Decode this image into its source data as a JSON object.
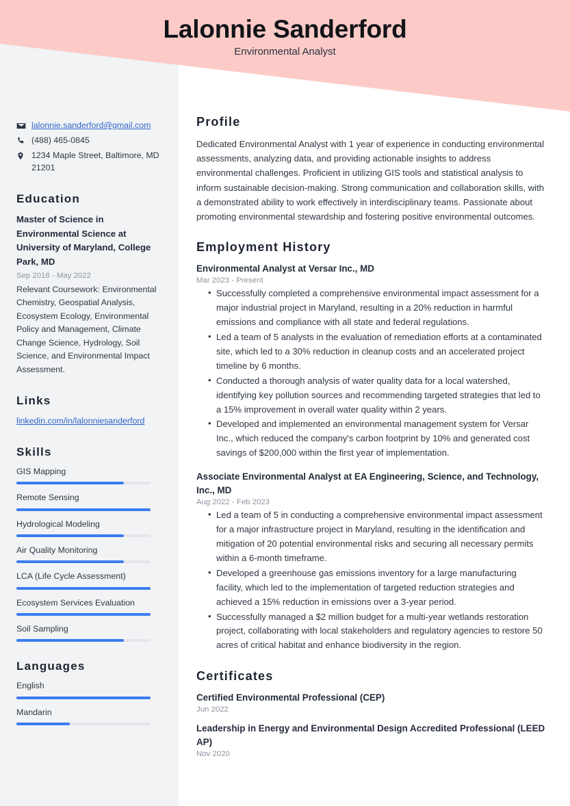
{
  "theme": {
    "band_color": "#fdcbc7",
    "sidebar_color": "#f1f3f5",
    "accent_color": "#3b7ced",
    "link_color": "#3064c8",
    "text_color": "#2f3642",
    "muted_color": "#8d939e"
  },
  "header": {
    "name": "Lalonnie Sanderford",
    "title": "Environmental Analyst"
  },
  "contact": {
    "items": [
      {
        "icon": "envelope-icon",
        "value": "lalonnie.sanderford@gmail.com",
        "is_link": true
      },
      {
        "icon": "phone-icon",
        "value": "(488) 465-0845",
        "is_link": false
      },
      {
        "icon": "map-pin-icon",
        "value": "1234 Maple Street, Baltimore, MD 21201",
        "is_link": false
      }
    ]
  },
  "education": {
    "heading": "Education",
    "entries": [
      {
        "degree": "Master of Science in Environmental Science at University of Maryland, College Park, MD",
        "date": "Sep 2018 - May 2022",
        "description": "Relevant Coursework: Environmental Chemistry, Geospatial Analysis, Ecosystem Ecology, Environmental Policy and Management, Climate Change Science, Hydrology, Soil Science, and Environmental Impact Assessment."
      }
    ]
  },
  "links": {
    "heading": "Links",
    "items": [
      {
        "label": "linkedin.com/in/lalonniesanderford"
      }
    ]
  },
  "skills": {
    "heading": "Skills",
    "items": [
      {
        "label": "GIS Mapping",
        "level": 80
      },
      {
        "label": "Remote Sensing",
        "level": 100
      },
      {
        "label": "Hydrological Modeling",
        "level": 80
      },
      {
        "label": "Air Quality Monitoring",
        "level": 80
      },
      {
        "label": "LCA (Life Cycle Assessment)",
        "level": 100
      },
      {
        "label": "Ecosystem Services Evaluation",
        "level": 100
      },
      {
        "label": "Soil Sampling",
        "level": 80
      }
    ]
  },
  "languages": {
    "heading": "Languages",
    "items": [
      {
        "label": "English",
        "level": 100
      },
      {
        "label": "Mandarin",
        "level": 40
      }
    ]
  },
  "profile": {
    "heading": "Profile",
    "text": "Dedicated Environmental Analyst with 1 year of experience in conducting environmental assessments, analyzing data, and providing actionable insights to address environmental challenges. Proficient in utilizing GIS tools and statistical analysis to inform sustainable decision-making. Strong communication and collaboration skills, with a demonstrated ability to work effectively in interdisciplinary teams. Passionate about promoting environmental stewardship and fostering positive environmental outcomes."
  },
  "employment": {
    "heading": "Employment History",
    "jobs": [
      {
        "title": "Environmental Analyst at Versar Inc., MD",
        "date": "Mar 2023 - Present",
        "bullets": [
          "Successfully completed a comprehensive environmental impact assessment for a major industrial project in Maryland, resulting in a 20% reduction in harmful emissions and compliance with all state and federal regulations.",
          "Led a team of 5 analysts in the evaluation of remediation efforts at a contaminated site, which led to a 30% reduction in cleanup costs and an accelerated project timeline by 6 months.",
          "Conducted a thorough analysis of water quality data for a local watershed, identifying key pollution sources and recommending targeted strategies that led to a 15% improvement in overall water quality within 2 years.",
          "Developed and implemented an environmental management system for Versar Inc., which reduced the company's carbon footprint by 10% and generated cost savings of $200,000 within the first year of implementation."
        ]
      },
      {
        "title": "Associate Environmental Analyst at EA Engineering, Science, and Technology, Inc., MD",
        "date": "Aug 2022 - Feb 2023",
        "bullets": [
          "Led a team of 5 in conducting a comprehensive environmental impact assessment for a major infrastructure project in Maryland, resulting in the identification and mitigation of 20 potential environmental risks and securing all necessary permits within a 6-month timeframe.",
          "Developed a greenhouse gas emissions inventory for a large manufacturing facility, which led to the implementation of targeted reduction strategies and achieved a 15% reduction in emissions over a 3-year period.",
          "Successfully managed a $2 million budget for a multi-year wetlands restoration project, collaborating with local stakeholders and regulatory agencies to restore 50 acres of critical habitat and enhance biodiversity in the region."
        ]
      }
    ]
  },
  "certificates": {
    "heading": "Certificates",
    "items": [
      {
        "name": "Certified Environmental Professional (CEP)",
        "date": "Jun 2022"
      },
      {
        "name": "Leadership in Energy and Environmental Design Accredited Professional (LEED AP)",
        "date": "Nov 2020"
      }
    ]
  }
}
